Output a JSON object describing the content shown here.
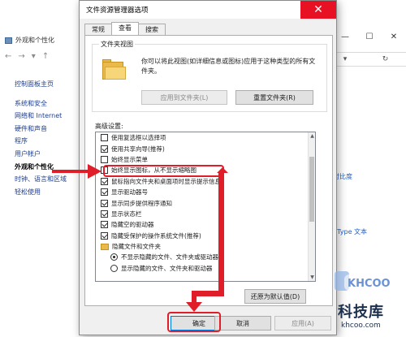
{
  "background": {
    "window_title": "外观和个性化",
    "nav_glyphs": [
      "←",
      "→",
      "▾",
      "↑"
    ],
    "window_controls": [
      "—",
      "☐",
      "✕"
    ],
    "addr_glyphs": [
      "▾",
      "↻"
    ],
    "sidebar": [
      {
        "label": "控制面板主页"
      },
      {
        "label": "系统和安全"
      },
      {
        "label": "网络和 Internet"
      },
      {
        "label": "硬件和声音"
      },
      {
        "label": "程序"
      },
      {
        "label": "用户帐户"
      },
      {
        "label": "外观和个性化"
      },
      {
        "label": "时钟、语言和区域"
      },
      {
        "label": "轻松使用"
      }
    ],
    "right_texts": [
      "高对比度",
      "earType 文本"
    ]
  },
  "dialog": {
    "title": "文件资源管理器选项",
    "close_glyph": "✕",
    "tabs": [
      {
        "label": "常规"
      },
      {
        "label": "查看"
      },
      {
        "label": "搜索"
      }
    ],
    "folder_views": {
      "legend": "文件夹视图",
      "description": "你可以将此视图(如详细信息或图标)应用于这种类型的所有文件夹。",
      "apply_button": "应用到文件夹(L)",
      "reset_button": "重置文件夹(R)"
    },
    "advanced_label": "高级设置:",
    "advanced_items": [
      {
        "type": "check",
        "checked": false,
        "label": "使用复选框以选择项",
        "indent": false
      },
      {
        "type": "check",
        "checked": true,
        "label": "使用共享向导(推荐)",
        "indent": false
      },
      {
        "type": "check",
        "checked": false,
        "label": "始终显示菜单",
        "indent": false
      },
      {
        "type": "check",
        "checked": false,
        "label": "始终显示图标，从不显示缩略图",
        "indent": false
      },
      {
        "type": "check",
        "checked": true,
        "label": "鼠标指向文件夹和桌面项时显示提示信息",
        "indent": false
      },
      {
        "type": "check",
        "checked": true,
        "label": "显示驱动器号",
        "indent": false
      },
      {
        "type": "check",
        "checked": true,
        "label": "显示同步提供程序通知",
        "indent": false
      },
      {
        "type": "check",
        "checked": true,
        "label": "显示状态栏",
        "indent": false
      },
      {
        "type": "check",
        "checked": true,
        "label": "隐藏空的驱动器",
        "indent": false
      },
      {
        "type": "check",
        "checked": true,
        "label": "隐藏受保护的操作系统文件(推荐)",
        "indent": false
      },
      {
        "type": "folder",
        "checked": false,
        "label": "隐藏文件和文件夹",
        "indent": false
      },
      {
        "type": "radio",
        "checked": true,
        "label": "不显示隐藏的文件、文件夹或驱动器",
        "indent": true
      },
      {
        "type": "radio",
        "checked": false,
        "label": "显示隐藏的文件、文件夹和驱动器",
        "indent": true
      }
    ],
    "restore_button": "还原为默认值(D)",
    "ok_button": "确定",
    "cancel_button": "取消",
    "apply_button": "应用(A)"
  },
  "scroll_glyphs": [
    "▲",
    "▼"
  ],
  "watermark": {
    "logo_text": "KHCOO",
    "name": "科技库",
    "url": "khcoo.com"
  },
  "colors": {
    "highlight": "#e01e2a",
    "close": "#e81123",
    "accent": "#0078d7"
  }
}
